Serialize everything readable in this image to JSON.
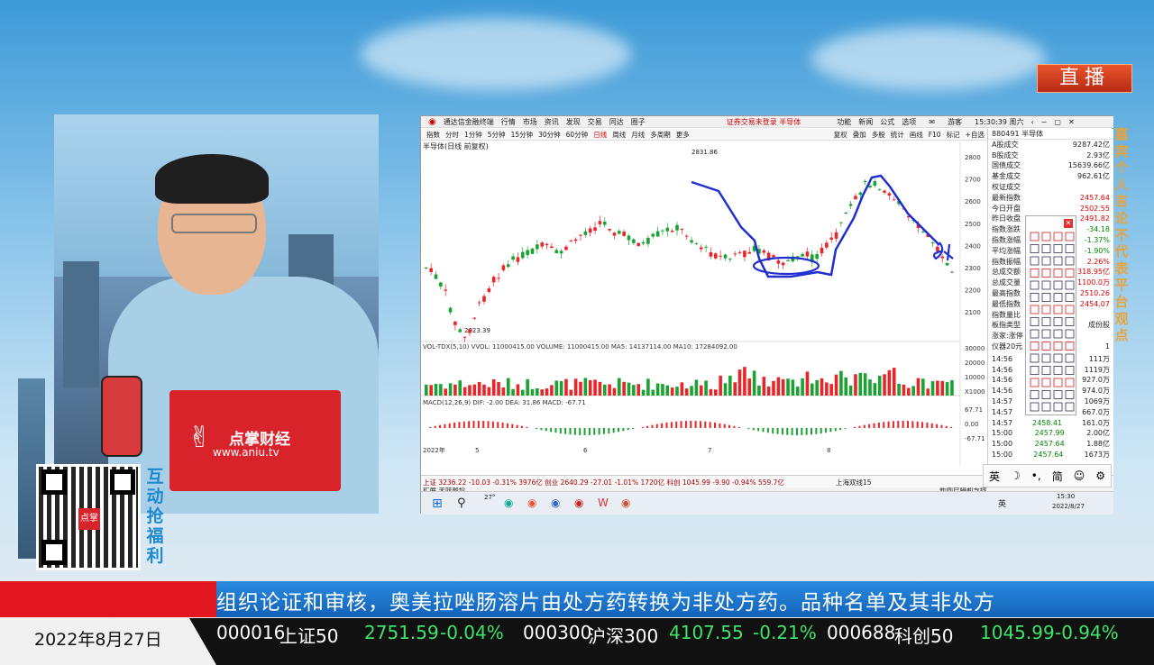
{
  "live_badge": "直播",
  "disclaimer": "嘉宾个人言论不代表平台观点",
  "host_panel": {
    "logo_text": "点掌财经",
    "logo_url": "www.aniu.tv",
    "promo_text": "互动抢福利"
  },
  "software": {
    "app_title": "通达信金融终端",
    "menu": [
      "行情",
      "市场",
      "资讯",
      "发现",
      "交易",
      "同达",
      "圈子"
    ],
    "notice": "证券交易未登录  半导体",
    "right_menu": [
      "功能",
      "新闻",
      "公式",
      "选项"
    ],
    "login": "游客",
    "clock": "15:30:39 周六",
    "toolbar": [
      "指数",
      "分时",
      "1分钟",
      "5分钟",
      "15分钟",
      "30分钟",
      "60分钟",
      "日线",
      "周线",
      "月线",
      "多周期",
      "更多"
    ],
    "toolbar_active": "日线",
    "toolbar_right": [
      "复权",
      "叠加",
      "多股",
      "统计",
      "画线",
      "F10",
      "标记",
      "+自选",
      "返回"
    ],
    "chart_title": "半导体(日线 前复权)",
    "price_high": "2831.86",
    "price_low": "2023.39",
    "y_ticks": [
      "2800",
      "2700",
      "2600",
      "2500",
      "2400",
      "2300",
      "2200",
      "2100"
    ],
    "vol_label": "VOL-TDX(5,10)  VVOL: 11000415.00  VOLUME: 11000415.00  MA5: 14137114.00  MA10: 17284092.00",
    "vol_ticks": [
      "30000",
      "20000",
      "10000",
      "X1000"
    ],
    "macd_label": "MACD(12,26,9)  DIF: -2.00  DEA: 31.86  MACD: -67.71",
    "macd_ticks": [
      "67.71",
      "0.00",
      "-67.71"
    ],
    "x_labels": [
      "2022年",
      "5",
      "6",
      "7",
      "8"
    ],
    "bottom_tabs": [
      "指标A",
      "指标B",
      "模板",
      "管理",
      "另存为",
      "绑定到",
      "缠论主图",
      "缠论布林",
      "缠论均线",
      "缠论画笔",
      "中长期均线",
      "SS"
    ],
    "sub_row": "扩展   关联报价",
    "status_indexes": "上证 3236.22  -10.03  -0.31%  3976亿   创业 2640.29  -27.01  -1.01%  1720亿   科创 1045.99  -9.90  -0.94%  559.7亿",
    "status_right": "上海双线15",
    "status_right2": "新闻户隔利专线",
    "side_code": "880491  半导体",
    "side_rows": [
      [
        "A股成交",
        "9287.42亿"
      ],
      [
        "B股成交",
        "2.93亿"
      ],
      [
        "国债成交",
        "15639.66亿"
      ],
      [
        "基金成交",
        "962.61亿"
      ],
      [
        "权证成交",
        ""
      ],
      [
        "最新指数",
        "2457.64"
      ],
      [
        "今日开盘",
        "2502.55"
      ],
      [
        "昨日收盘",
        "2491.82"
      ],
      [
        "指数涨跌",
        "-34.18"
      ],
      [
        "指数涨幅",
        "-1.37%"
      ],
      [
        "平均涨幅",
        "-1.90%"
      ],
      [
        "指数振幅",
        "2.26%"
      ],
      [
        "总成交额",
        "318.95亿"
      ],
      [
        "总成交量",
        "1100.0万"
      ],
      [
        "最高指数",
        "2510.26"
      ],
      [
        "最低指数",
        "2454.07"
      ],
      [
        "指数量比",
        ""
      ],
      [
        "板指类型",
        "成份股"
      ],
      [
        "涨家:涨停",
        ""
      ],
      [
        "仪器20元",
        "1"
      ]
    ],
    "trades": [
      [
        "14:56",
        "",
        "111万"
      ],
      [
        "14:56",
        "",
        "1119万"
      ],
      [
        "14:56",
        "",
        "927.0万"
      ],
      [
        "14:56",
        "",
        "974.0万"
      ],
      [
        "14:57",
        "2458.40",
        "1069万"
      ],
      [
        "14:57",
        "2458.40",
        "667.0万"
      ],
      [
        "14:57",
        "2458.41",
        "161.0万"
      ],
      [
        "15:00",
        "2457.99",
        "2.00亿"
      ],
      [
        "15:00",
        "2457.64",
        "1.88亿"
      ],
      [
        "15:00",
        "2457.64",
        "1673万"
      ]
    ],
    "tray_time": "15:30",
    "tray_date": "2022/8/27",
    "tray_lang": "英",
    "weather": "27°"
  },
  "ime": {
    "lang": "英",
    "mode": "简"
  },
  "news_ticker": "组织论证和审核，奥美拉唑肠溶片由处方药转换为非处方药。品种名单及其非处方",
  "date": "2022年8月27日",
  "quotes": [
    {
      "code": "000016",
      "name": "上证50",
      "price": "2751.59",
      "change": "-0.04%"
    },
    {
      "code": "000300",
      "name": "沪深300",
      "price": "4107.55",
      "change": "-0.21%"
    },
    {
      "code": "000688",
      "name": "科创50",
      "price": "1045.99",
      "change": "-0.94%"
    }
  ],
  "colors": {
    "up": "#e8262a",
    "down": "#1aa332",
    "ticker_blue": "#1f76cf",
    "accent_red": "#e2161e"
  }
}
